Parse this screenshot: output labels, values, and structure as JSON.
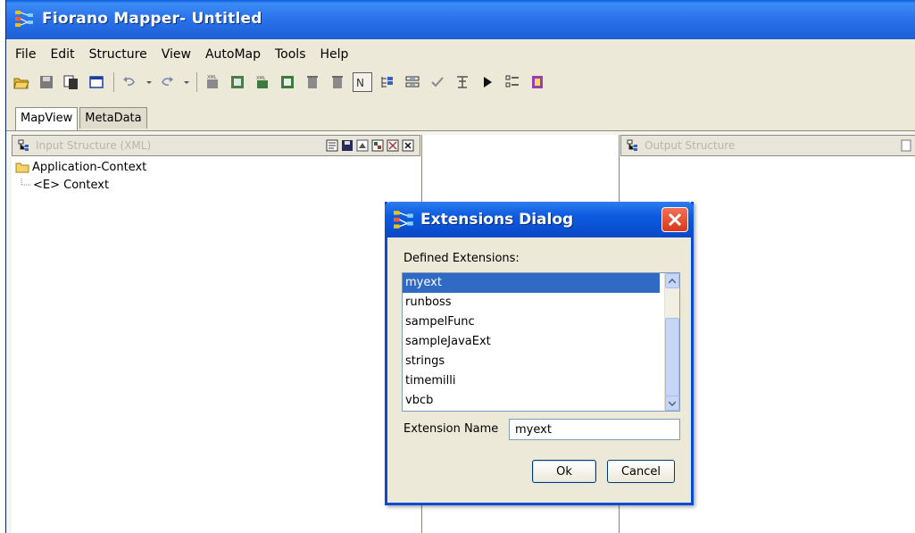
{
  "window": {
    "title": "Fiorano Mapper- Untitled"
  },
  "menu": [
    "File",
    "Edit",
    "Structure",
    "View",
    "AutoMap",
    "Tools",
    "Help"
  ],
  "toolbar": {
    "icons": [
      "open-icon",
      "save-icon",
      "copy-icon",
      "new-window-icon",
      "undo-icon",
      "redo-icon",
      "xml-input-icon",
      "load-structure-icon",
      "xml-output-icon",
      "load-output-icon",
      "delete-icon",
      "delete-all-icon",
      "line-mode-icon",
      "tree-expand-icon",
      "tree-collapse-icon",
      "validate-icon",
      "align-icon",
      "run-icon",
      "list-icon",
      "help-book-icon"
    ]
  },
  "tabs": [
    {
      "label": "MapView",
      "active": true
    },
    {
      "label": "MetaData",
      "active": false
    }
  ],
  "left_panel": {
    "header_title": "Input Structure (XML)",
    "tree": [
      {
        "label": "Application-Context",
        "icon": "folder-icon"
      },
      {
        "label": "<E> Context",
        "icon": "element-icon"
      }
    ]
  },
  "right_panel": {
    "header_title": "Output Structure"
  },
  "dialog": {
    "title": "Extensions Dialog",
    "defined_label": "Defined Extensions:",
    "extensions": [
      "myext",
      "runboss",
      "sampelFunc",
      "sampleJavaExt",
      "strings",
      "timemilli",
      "vbcb"
    ],
    "selected": "myext",
    "name_label": "Extension Name",
    "name_value": "myext",
    "ok_label": "Ok",
    "cancel_label": "Cancel"
  },
  "colors": {
    "titlebar": "#2b74ec",
    "selection": "#316ac5",
    "close_button": "#e04f32",
    "window_bg": "#ece9d8"
  }
}
